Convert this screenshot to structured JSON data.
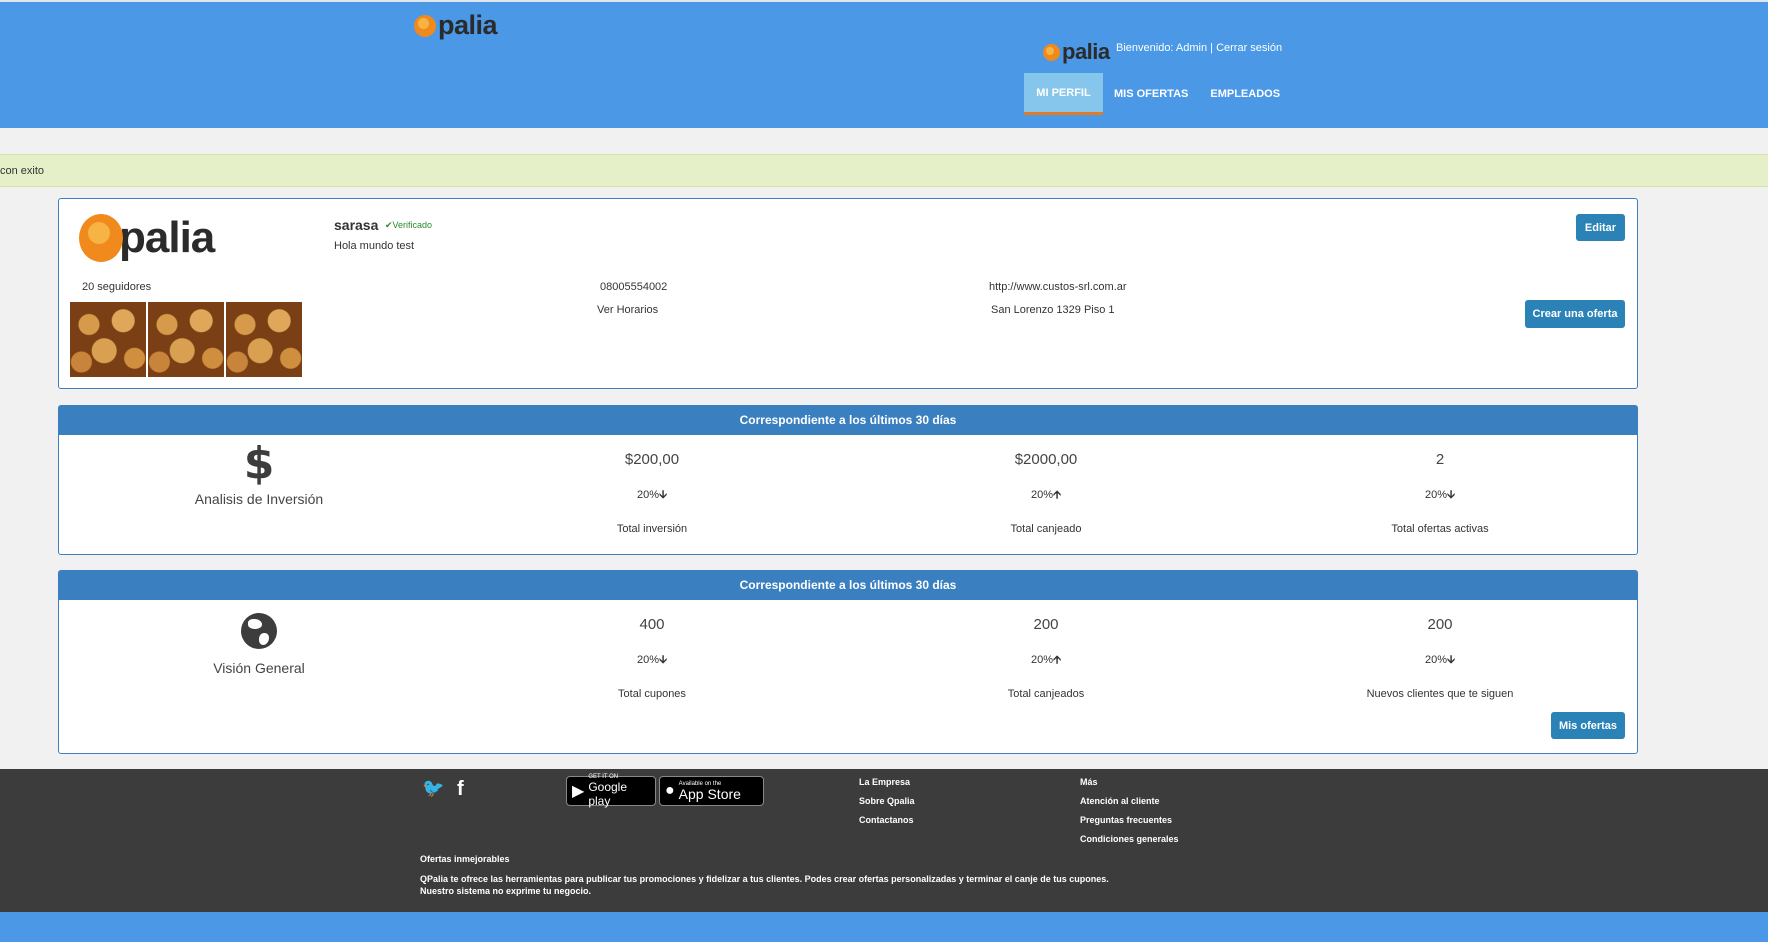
{
  "header": {
    "logo_text": "palia",
    "small_logo_text": "palia",
    "welcome": "Bienvenido: Admin | Cerrar sesión",
    "nav": [
      "MI PERFIL",
      "MIS OFERTAS",
      "EMPLEADOS"
    ],
    "active_nav": "MI PERFIL"
  },
  "alert": {
    "text": "con exito"
  },
  "profile": {
    "logo_text": "palia",
    "name": "sarasa",
    "verified": "✔Verificado",
    "description": "Hola mundo test",
    "followers": "20 seguidores",
    "phone": "08005554002",
    "hours": "Ver Horarios",
    "website": "http://www.custos-srl.com.ar",
    "address": "San Lorenzo 1329 Piso 1",
    "edit_label": "Editar",
    "create_offer_label": "Crear una oferta"
  },
  "investment": {
    "header": "Correspondiente a los últimos 30 días",
    "icon": "$",
    "title": "Analisis de Inversión",
    "columns": [
      {
        "value": "$200,00",
        "pct": "20%",
        "arrow": "down",
        "arrow_glyph": "🡫",
        "label": "Total inversión"
      },
      {
        "value": "$2000,00",
        "pct": "20%",
        "arrow": "up",
        "arrow_glyph": "🡩",
        "label": "Total canjeado"
      },
      {
        "value": "2",
        "pct": "20%",
        "arrow": "down",
        "arrow_glyph": "🡫",
        "label": "Total ofertas activas"
      }
    ]
  },
  "overview": {
    "header": "Correspondiente a los últimos 30 días",
    "title": "Visión General",
    "columns": [
      {
        "value": "400",
        "pct": "20%",
        "arrow": "down",
        "arrow_glyph": "🡫",
        "label": "Total cupones"
      },
      {
        "value": "200",
        "pct": "20%",
        "arrow": "up",
        "arrow_glyph": "🡩",
        "label": "Total canjeados"
      },
      {
        "value": "200",
        "pct": "20%",
        "arrow": "down",
        "arrow_glyph": "🡫",
        "label": "Nuevos clientes que te siguen"
      }
    ],
    "my_offers_label": "Mis ofertas"
  },
  "footer": {
    "google_small": "GET IT ON",
    "google_big": "Google play",
    "apple_small": "Available on the",
    "apple_big": "App Store",
    "company_links": [
      "La Empresa",
      "Sobre Qpalia",
      "Contactanos"
    ],
    "more_links": [
      "Más",
      "Atención al cliente",
      "Preguntas frecuentes",
      "Condiciones generales"
    ],
    "about_title": "Ofertas inmejorables",
    "about_text": "QPalia te ofrece las herramientas para publicar tus promociones y fidelizar a tus clientes. Podes crear ofertas personalizadas y terminar el canje de tus cupones. Nuestro sistema no exprime tu negocio."
  },
  "colors": {
    "header_blue": "#4a98e6",
    "panel_blue": "#3a7fbf",
    "button_blue": "#2b82b7",
    "accent_orange": "#e27c22",
    "alert_green": "#e5efc8",
    "footer_dark": "#3c3c3c"
  }
}
